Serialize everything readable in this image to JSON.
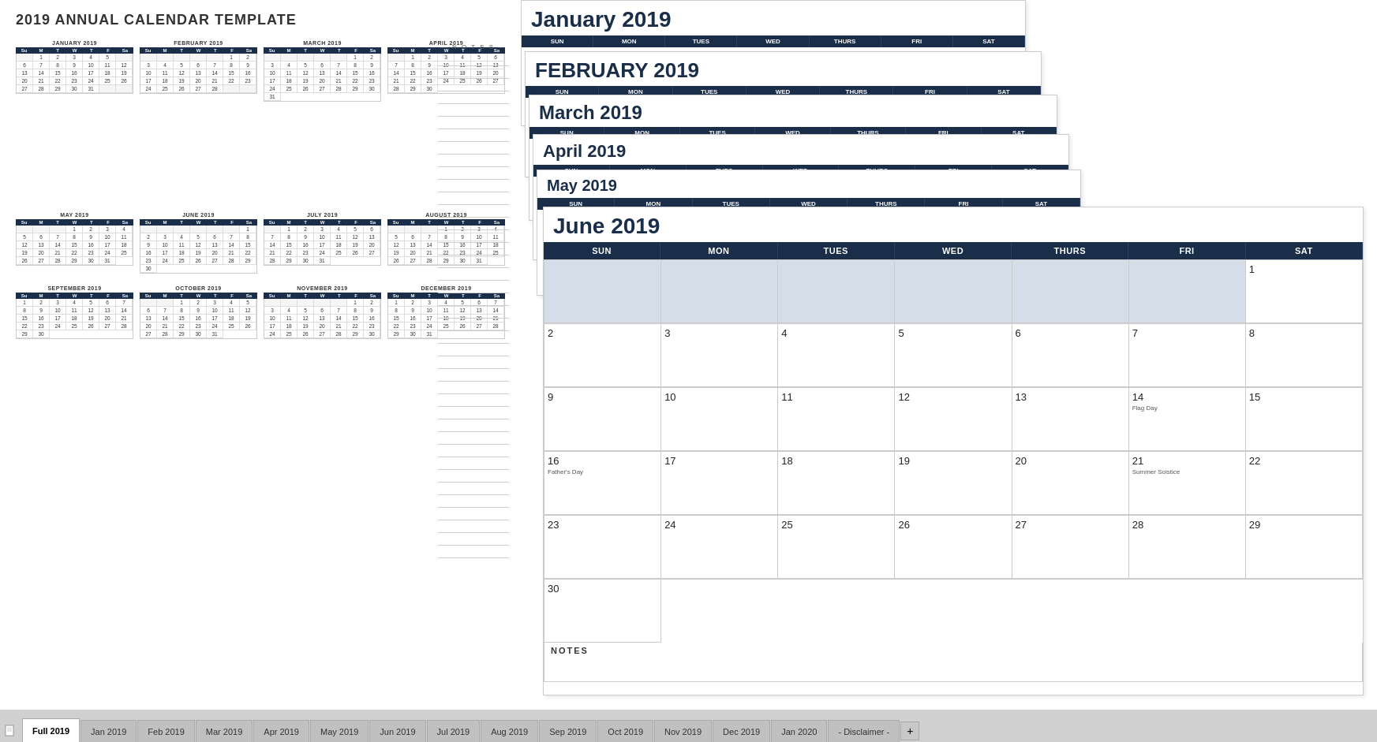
{
  "title": "2019 ANNUAL CALENDAR TEMPLATE",
  "months": {
    "jan": {
      "name": "JANUARY 2019",
      "headers": [
        "Su",
        "M",
        "T",
        "W",
        "T",
        "F",
        "Sa"
      ],
      "days": [
        "",
        "1",
        "2",
        "3",
        "4",
        "5",
        "",
        "6",
        "7",
        "8",
        "9",
        "10",
        "11",
        "12",
        "13",
        "14",
        "15",
        "16",
        "17",
        "18",
        "19",
        "20",
        "21",
        "22",
        "23",
        "24",
        "25",
        "26",
        "27",
        "28",
        "29",
        "30",
        "31"
      ]
    },
    "feb": {
      "name": "FEBRUARY 2019",
      "headers": [
        "Su",
        "M",
        "T",
        "W",
        "T",
        "F",
        "Sa"
      ],
      "days": [
        "",
        "",
        "",
        "",
        "",
        "1",
        "2",
        "3",
        "4",
        "5",
        "6",
        "7",
        "8",
        "9",
        "10",
        "11",
        "12",
        "13",
        "14",
        "15",
        "16",
        "17",
        "18",
        "19",
        "20",
        "21",
        "22",
        "23",
        "24",
        "25",
        "26",
        "27",
        "28"
      ]
    },
    "mar": {
      "name": "MARCH 2019",
      "headers": [
        "Su",
        "M",
        "T",
        "W",
        "T",
        "F",
        "Sa"
      ],
      "days": [
        "",
        "",
        "",
        "",
        "",
        "1",
        "2",
        "3",
        "4",
        "5",
        "6",
        "7",
        "8",
        "9",
        "10",
        "11",
        "12",
        "13",
        "14",
        "15",
        "16",
        "17",
        "18",
        "19",
        "20",
        "21",
        "22",
        "23",
        "24",
        "25",
        "26",
        "27",
        "28",
        "29",
        "30",
        "31"
      ]
    },
    "apr": {
      "name": "APRIL 2019",
      "headers": [
        "Su",
        "M",
        "T",
        "W",
        "T",
        "F",
        "Sa"
      ],
      "days": [
        "",
        "1",
        "2",
        "3",
        "4",
        "5",
        "6",
        "7",
        "8",
        "9",
        "10",
        "11",
        "12",
        "13",
        "14",
        "15",
        "16",
        "17",
        "18",
        "19",
        "20",
        "21",
        "22",
        "23",
        "24",
        "25",
        "26",
        "27",
        "28",
        "29",
        "30"
      ]
    },
    "may": {
      "name": "MAY 2019",
      "headers": [
        "Su",
        "M",
        "T",
        "W",
        "T",
        "F",
        "Sa"
      ],
      "days": [
        "",
        "",
        "",
        "1",
        "2",
        "3",
        "4",
        "5",
        "6",
        "7",
        "8",
        "9",
        "10",
        "11",
        "12",
        "13",
        "14",
        "15",
        "16",
        "17",
        "18",
        "19",
        "20",
        "21",
        "22",
        "23",
        "24",
        "25",
        "26",
        "27",
        "28",
        "29",
        "30",
        "31"
      ]
    },
    "jun": {
      "name": "JUNE 2019",
      "headers": [
        "Su",
        "M",
        "T",
        "W",
        "T",
        "F",
        "Sa"
      ],
      "days": [
        "",
        "",
        "",
        "",
        "",
        "",
        "1",
        "2",
        "3",
        "4",
        "5",
        "6",
        "7",
        "8",
        "9",
        "10",
        "11",
        "12",
        "13",
        "14",
        "15",
        "16",
        "17",
        "18",
        "19",
        "20",
        "21",
        "22",
        "23",
        "24",
        "25",
        "26",
        "27",
        "28",
        "29",
        "30"
      ]
    },
    "jul": {
      "name": "JULY 2019",
      "headers": [
        "Su",
        "M",
        "T",
        "W",
        "T",
        "F",
        "Sa"
      ],
      "days": [
        "",
        "1",
        "2",
        "3",
        "4",
        "5",
        "6",
        "7",
        "8",
        "9",
        "10",
        "11",
        "12",
        "13",
        "14",
        "15",
        "16",
        "17",
        "18",
        "19",
        "20",
        "21",
        "22",
        "23",
        "24",
        "25",
        "26",
        "27",
        "28",
        "29",
        "30",
        "31"
      ]
    },
    "aug": {
      "name": "AUGUST 2019",
      "headers": [
        "Su",
        "M",
        "T",
        "W",
        "T",
        "F",
        "Sa"
      ],
      "days": [
        "",
        "",
        "",
        "1",
        "2",
        "3",
        "4",
        "5",
        "6",
        "7",
        "8",
        "9",
        "10",
        "11",
        "12",
        "13",
        "14",
        "15",
        "16",
        "17",
        "18",
        "19",
        "20",
        "21",
        "22",
        "23",
        "24",
        "25",
        "26",
        "27",
        "28",
        "29",
        "30",
        "31"
      ]
    },
    "sep": {
      "name": "SEPTEMBER 2019",
      "headers": [
        "Su",
        "M",
        "T",
        "W",
        "T",
        "F",
        "Sa"
      ],
      "days": [
        "1",
        "2",
        "3",
        "4",
        "5",
        "6",
        "7",
        "8",
        "9",
        "10",
        "11",
        "12",
        "13",
        "14",
        "15",
        "16",
        "17",
        "18",
        "19",
        "20",
        "21",
        "22",
        "23",
        "24",
        "25",
        "26",
        "27",
        "28",
        "29",
        "30"
      ]
    },
    "oct": {
      "name": "OCTOBER 2019",
      "headers": [
        "Su",
        "M",
        "T",
        "W",
        "T",
        "F",
        "Sa"
      ],
      "days": [
        "",
        "",
        "1",
        "2",
        "3",
        "4",
        "5",
        "6",
        "7",
        "8",
        "9",
        "10",
        "11",
        "12",
        "13",
        "14",
        "15",
        "16",
        "17",
        "18",
        "19",
        "20",
        "21",
        "22",
        "23",
        "24",
        "25",
        "26",
        "27",
        "28",
        "29",
        "30",
        "31"
      ]
    },
    "nov": {
      "name": "NOVEMBER 2019",
      "headers": [
        "Su",
        "M",
        "T",
        "W",
        "T",
        "F",
        "Sa"
      ],
      "days": [
        "",
        "",
        "",
        "",
        "",
        "1",
        "2",
        "3",
        "4",
        "5",
        "6",
        "7",
        "8",
        "9",
        "10",
        "11",
        "12",
        "13",
        "14",
        "15",
        "16",
        "17",
        "18",
        "19",
        "20",
        "21",
        "22",
        "23",
        "24",
        "25",
        "26",
        "27",
        "28",
        "29",
        "30"
      ]
    },
    "dec": {
      "name": "DECEMBER 2019",
      "headers": [
        "Su",
        "M",
        "T",
        "W",
        "T",
        "F",
        "Sa"
      ],
      "days": [
        "1",
        "2",
        "3",
        "4",
        "5",
        "6",
        "7",
        "8",
        "9",
        "10",
        "11",
        "12",
        "13",
        "14",
        "15",
        "16",
        "17",
        "18",
        "19",
        "20",
        "21",
        "22",
        "23",
        "24",
        "25",
        "26",
        "27",
        "28",
        "29",
        "30",
        "31"
      ]
    }
  },
  "notes_title": "— N O T E S —",
  "june_full": {
    "title": "June 2019",
    "headers": [
      "SUN",
      "MON",
      "TUES",
      "WED",
      "THURS",
      "FRI",
      "SAT"
    ],
    "week1": [
      "",
      "",
      "",
      "",
      "",
      "",
      "1"
    ],
    "week2": [
      "2",
      "3",
      "4",
      "5",
      "6",
      "7",
      "8"
    ],
    "week3": [
      "9",
      "10",
      "11",
      "12",
      "13",
      "14",
      "15"
    ],
    "week4": [
      "16",
      "17",
      "18",
      "19",
      "20",
      "21",
      "22"
    ],
    "week5": [
      "23",
      "24",
      "25",
      "26",
      "27",
      "28",
      "29"
    ],
    "week6": [
      "30",
      "",
      "",
      "",
      "",
      "",
      ""
    ],
    "notes_label": "NOTES",
    "flag_day": "Flag Day",
    "fathers_day": "Father's Day",
    "summer_solstice": "Summer Solstice"
  },
  "tabs": [
    {
      "label": "Full 2019",
      "active": true
    },
    {
      "label": "Jan 2019",
      "active": false
    },
    {
      "label": "Feb 2019",
      "active": false
    },
    {
      "label": "Mar 2019",
      "active": false
    },
    {
      "label": "Apr 2019",
      "active": false
    },
    {
      "label": "May 2019",
      "active": false
    },
    {
      "label": "Jun 2019",
      "active": false
    },
    {
      "label": "Jul 2019",
      "active": false
    },
    {
      "label": "Aug 2019",
      "active": false
    },
    {
      "label": "Sep 2019",
      "active": false
    },
    {
      "label": "Oct 2019",
      "active": false
    },
    {
      "label": "Nov 2019",
      "active": false
    },
    {
      "label": "Dec 2019",
      "active": false
    },
    {
      "label": "Jan 2020",
      "active": false
    },
    {
      "label": "- Disclaimer -",
      "active": false
    }
  ]
}
